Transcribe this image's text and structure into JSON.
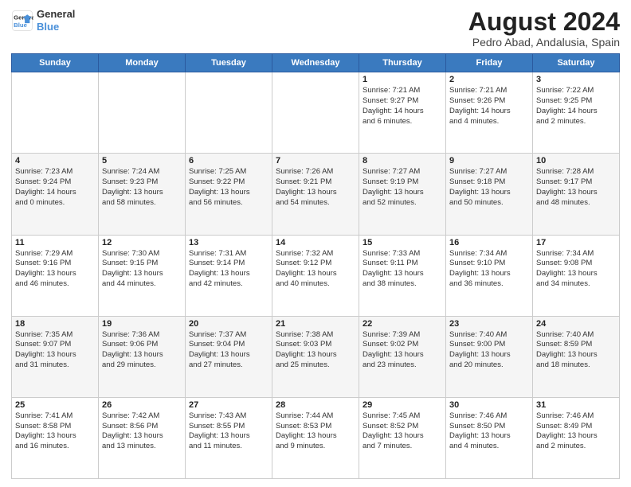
{
  "logo": {
    "line1": "General",
    "line2": "Blue"
  },
  "title": "August 2024",
  "subtitle": "Pedro Abad, Andalusia, Spain",
  "weekdays": [
    "Sunday",
    "Monday",
    "Tuesday",
    "Wednesday",
    "Thursday",
    "Friday",
    "Saturday"
  ],
  "weeks": [
    [
      {
        "day": "",
        "info": ""
      },
      {
        "day": "",
        "info": ""
      },
      {
        "day": "",
        "info": ""
      },
      {
        "day": "",
        "info": ""
      },
      {
        "day": "1",
        "info": "Sunrise: 7:21 AM\nSunset: 9:27 PM\nDaylight: 14 hours\nand 6 minutes."
      },
      {
        "day": "2",
        "info": "Sunrise: 7:21 AM\nSunset: 9:26 PM\nDaylight: 14 hours\nand 4 minutes."
      },
      {
        "day": "3",
        "info": "Sunrise: 7:22 AM\nSunset: 9:25 PM\nDaylight: 14 hours\nand 2 minutes."
      }
    ],
    [
      {
        "day": "4",
        "info": "Sunrise: 7:23 AM\nSunset: 9:24 PM\nDaylight: 14 hours\nand 0 minutes."
      },
      {
        "day": "5",
        "info": "Sunrise: 7:24 AM\nSunset: 9:23 PM\nDaylight: 13 hours\nand 58 minutes."
      },
      {
        "day": "6",
        "info": "Sunrise: 7:25 AM\nSunset: 9:22 PM\nDaylight: 13 hours\nand 56 minutes."
      },
      {
        "day": "7",
        "info": "Sunrise: 7:26 AM\nSunset: 9:21 PM\nDaylight: 13 hours\nand 54 minutes."
      },
      {
        "day": "8",
        "info": "Sunrise: 7:27 AM\nSunset: 9:19 PM\nDaylight: 13 hours\nand 52 minutes."
      },
      {
        "day": "9",
        "info": "Sunrise: 7:27 AM\nSunset: 9:18 PM\nDaylight: 13 hours\nand 50 minutes."
      },
      {
        "day": "10",
        "info": "Sunrise: 7:28 AM\nSunset: 9:17 PM\nDaylight: 13 hours\nand 48 minutes."
      }
    ],
    [
      {
        "day": "11",
        "info": "Sunrise: 7:29 AM\nSunset: 9:16 PM\nDaylight: 13 hours\nand 46 minutes."
      },
      {
        "day": "12",
        "info": "Sunrise: 7:30 AM\nSunset: 9:15 PM\nDaylight: 13 hours\nand 44 minutes."
      },
      {
        "day": "13",
        "info": "Sunrise: 7:31 AM\nSunset: 9:14 PM\nDaylight: 13 hours\nand 42 minutes."
      },
      {
        "day": "14",
        "info": "Sunrise: 7:32 AM\nSunset: 9:12 PM\nDaylight: 13 hours\nand 40 minutes."
      },
      {
        "day": "15",
        "info": "Sunrise: 7:33 AM\nSunset: 9:11 PM\nDaylight: 13 hours\nand 38 minutes."
      },
      {
        "day": "16",
        "info": "Sunrise: 7:34 AM\nSunset: 9:10 PM\nDaylight: 13 hours\nand 36 minutes."
      },
      {
        "day": "17",
        "info": "Sunrise: 7:34 AM\nSunset: 9:08 PM\nDaylight: 13 hours\nand 34 minutes."
      }
    ],
    [
      {
        "day": "18",
        "info": "Sunrise: 7:35 AM\nSunset: 9:07 PM\nDaylight: 13 hours\nand 31 minutes."
      },
      {
        "day": "19",
        "info": "Sunrise: 7:36 AM\nSunset: 9:06 PM\nDaylight: 13 hours\nand 29 minutes."
      },
      {
        "day": "20",
        "info": "Sunrise: 7:37 AM\nSunset: 9:04 PM\nDaylight: 13 hours\nand 27 minutes."
      },
      {
        "day": "21",
        "info": "Sunrise: 7:38 AM\nSunset: 9:03 PM\nDaylight: 13 hours\nand 25 minutes."
      },
      {
        "day": "22",
        "info": "Sunrise: 7:39 AM\nSunset: 9:02 PM\nDaylight: 13 hours\nand 23 minutes."
      },
      {
        "day": "23",
        "info": "Sunrise: 7:40 AM\nSunset: 9:00 PM\nDaylight: 13 hours\nand 20 minutes."
      },
      {
        "day": "24",
        "info": "Sunrise: 7:40 AM\nSunset: 8:59 PM\nDaylight: 13 hours\nand 18 minutes."
      }
    ],
    [
      {
        "day": "25",
        "info": "Sunrise: 7:41 AM\nSunset: 8:58 PM\nDaylight: 13 hours\nand 16 minutes."
      },
      {
        "day": "26",
        "info": "Sunrise: 7:42 AM\nSunset: 8:56 PM\nDaylight: 13 hours\nand 13 minutes."
      },
      {
        "day": "27",
        "info": "Sunrise: 7:43 AM\nSunset: 8:55 PM\nDaylight: 13 hours\nand 11 minutes."
      },
      {
        "day": "28",
        "info": "Sunrise: 7:44 AM\nSunset: 8:53 PM\nDaylight: 13 hours\nand 9 minutes."
      },
      {
        "day": "29",
        "info": "Sunrise: 7:45 AM\nSunset: 8:52 PM\nDaylight: 13 hours\nand 7 minutes."
      },
      {
        "day": "30",
        "info": "Sunrise: 7:46 AM\nSunset: 8:50 PM\nDaylight: 13 hours\nand 4 minutes."
      },
      {
        "day": "31",
        "info": "Sunrise: 7:46 AM\nSunset: 8:49 PM\nDaylight: 13 hours\nand 2 minutes."
      }
    ]
  ]
}
